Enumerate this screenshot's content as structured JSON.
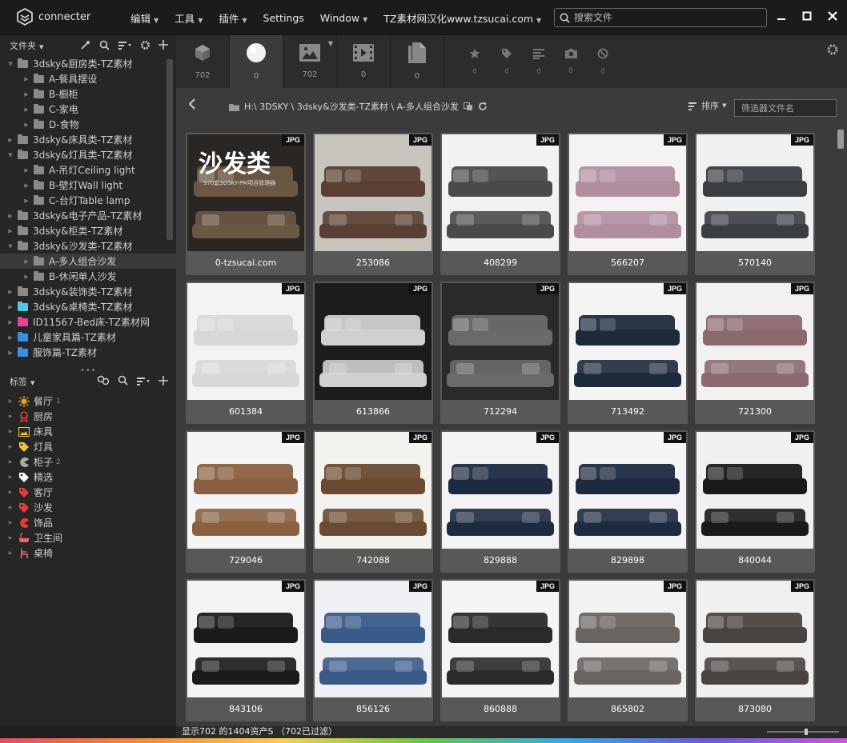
{
  "app": {
    "name": "connecter"
  },
  "menu": {
    "items": [
      {
        "label": "编辑",
        "dropdown": true
      },
      {
        "label": "工具",
        "dropdown": true
      },
      {
        "label": "插件",
        "dropdown": true
      },
      {
        "label": "Settings",
        "dropdown": false
      },
      {
        "label": "Window",
        "dropdown": true
      },
      {
        "label": "TZ素材网汉化www.tzsucai.com",
        "dropdown": true
      }
    ],
    "search_placeholder": "搜索文件"
  },
  "sidebar": {
    "folders_title": "文件夹",
    "folders": [
      {
        "label": "3dsky&厨房类-TZ素材",
        "level": 0,
        "expanded": true,
        "color": "#8a8a8a"
      },
      {
        "label": "A-餐具摆设",
        "level": 1,
        "color": "#8a8a8a"
      },
      {
        "label": "B-橱柜",
        "level": 1,
        "color": "#8a8a8a"
      },
      {
        "label": "C-家电",
        "level": 1,
        "color": "#8a8a8a"
      },
      {
        "label": "D-食物",
        "level": 1,
        "color": "#8a8a8a"
      },
      {
        "label": "3dsky&床具类-TZ素材",
        "level": 0,
        "color": "#8a8a8a"
      },
      {
        "label": "3dsky&灯具类-TZ素材",
        "level": 0,
        "expanded": true,
        "color": "#8a8a8a"
      },
      {
        "label": "A-吊灯Ceiling light",
        "level": 1,
        "color": "#8a8a8a"
      },
      {
        "label": "B-壁灯Wall light",
        "level": 1,
        "color": "#8a8a8a"
      },
      {
        "label": "C-台灯Table lamp",
        "level": 1,
        "color": "#8a8a8a"
      },
      {
        "label": "3dsky&电子产品-TZ素材",
        "level": 0,
        "color": "#8a8a8a"
      },
      {
        "label": "3dsky&柜类-TZ素材",
        "level": 0,
        "color": "#8a8a8a"
      },
      {
        "label": "3dsky&沙发类-TZ素材",
        "level": 0,
        "expanded": true,
        "color": "#8a8a8a"
      },
      {
        "label": "A-多人组合沙发",
        "level": 1,
        "selected": true,
        "color": "#8a8a8a"
      },
      {
        "label": "B-休闲单人沙发",
        "level": 1,
        "color": "#8a8a8a"
      },
      {
        "label": "3dsky&装饰类-TZ素材",
        "level": 0,
        "color": "#8a8a8a"
      },
      {
        "label": "3dsky&桌椅类-TZ素材",
        "level": 0,
        "color": "#4ec9e8"
      },
      {
        "label": "ID11567-Bed床-TZ素材网",
        "level": 0,
        "color": "#e84393"
      },
      {
        "label": "儿童家具篇-TZ素材",
        "level": 0,
        "color": "#3a8ee6"
      },
      {
        "label": "服饰篇-TZ素材",
        "level": 0,
        "color": "#3a8ee6"
      }
    ],
    "tags_title": "标签",
    "tags": [
      {
        "label": "餐厅",
        "count": "1",
        "icon": "sun-icon",
        "color": "#f0a020"
      },
      {
        "label": "厨房",
        "count": "",
        "icon": "badge-icon",
        "color": "#e83a3a"
      },
      {
        "label": "床具",
        "count": "",
        "icon": "image-icon",
        "color": "#f0c040"
      },
      {
        "label": "灯具",
        "count": "",
        "icon": "tag-icon",
        "color": "#f0c040"
      },
      {
        "label": "柜子",
        "count": "2",
        "icon": "pacman-icon",
        "color": "#aaaaaa"
      },
      {
        "label": "精选",
        "count": "",
        "icon": "tag-icon",
        "color": "#ffffff"
      },
      {
        "label": "客厅",
        "count": "",
        "icon": "tag-icon",
        "color": "#e83a3a"
      },
      {
        "label": "沙发",
        "count": "",
        "icon": "tag-icon",
        "color": "#e83a3a"
      },
      {
        "label": "饰品",
        "count": "",
        "icon": "pacman-icon",
        "color": "#e83a3a"
      },
      {
        "label": "卫生间",
        "count": "",
        "icon": "bathtub-icon",
        "color": "#e86a6a"
      },
      {
        "label": "桌椅",
        "count": "",
        "icon": "chair-icon",
        "color": "#e86a6a"
      }
    ]
  },
  "type_tabs": [
    {
      "name": "3d-model",
      "count": "702",
      "active": false
    },
    {
      "name": "material",
      "count": "0",
      "active": true
    },
    {
      "name": "image",
      "count": "702",
      "active": false
    },
    {
      "name": "video",
      "count": "0",
      "active": false
    },
    {
      "name": "document",
      "count": "0",
      "active": false
    }
  ],
  "meta_tabs": [
    {
      "name": "star",
      "count": "0"
    },
    {
      "name": "tag",
      "count": "0"
    },
    {
      "name": "text",
      "count": "0"
    },
    {
      "name": "camera",
      "count": "0"
    },
    {
      "name": "untagged",
      "count": "0"
    }
  ],
  "path": {
    "text": "H:\\ 3DSKY \\ 3dsky&沙发类-TZ素材 \\ A-多人组合沙发"
  },
  "sort_label": "排序",
  "filter_placeholder": "筛选器文件名",
  "assets": [
    {
      "label": "0-tzsucai.com",
      "badge": "JPG",
      "c1": "#2a2623",
      "c2": "#6b5844",
      "title": "沙发类",
      "sub": "970套3DSKY-PM项目管理器"
    },
    {
      "label": "253086",
      "badge": "JPG",
      "c1": "#c8c4be",
      "c2": "#5a4034"
    },
    {
      "label": "408299",
      "badge": "JPG",
      "c1": "#f2f2f2",
      "c2": "#4a4a48"
    },
    {
      "label": "566207",
      "badge": "JPG",
      "c1": "#f4f2f2",
      "c2": "#b08ea0"
    },
    {
      "label": "570140",
      "badge": "JPG",
      "c1": "#f0f0f0",
      "c2": "#3a3d42"
    },
    {
      "label": "601384",
      "badge": "JPG",
      "c1": "#f3f3f3",
      "c2": "#d8d8d8"
    },
    {
      "label": "613866",
      "badge": "JPG",
      "c1": "#1c1c1e",
      "c2": "#d0d0d0"
    },
    {
      "label": "712294",
      "badge": "JPG",
      "c1": "#2a2a2a",
      "c2": "#6a6a6a"
    },
    {
      "label": "713492",
      "badge": "JPG",
      "c1": "#f4f4f4",
      "c2": "#1e2a3a"
    },
    {
      "label": "721300",
      "badge": "JPG",
      "c1": "#f2f0f0",
      "c2": "#8a6a6e"
    },
    {
      "label": "729046",
      "badge": "JPG",
      "c1": "#f5f5f5",
      "c2": "#8a6040"
    },
    {
      "label": "742088",
      "badge": "JPG",
      "c1": "#f4f2ef",
      "c2": "#6a4a30"
    },
    {
      "label": "829888",
      "badge": "JPG",
      "c1": "#f3f3f3",
      "c2": "#1e2a40"
    },
    {
      "label": "829898",
      "badge": "JPG",
      "c1": "#f4f4f4",
      "c2": "#1e2a40"
    },
    {
      "label": "840044",
      "badge": "JPG",
      "c1": "#f2f0ee",
      "c2": "#1a1a1a"
    },
    {
      "label": "843106",
      "badge": "JPG",
      "c1": "#f3f3f3",
      "c2": "#1a1a1a"
    },
    {
      "label": "856126",
      "badge": "JPG",
      "c1": "#eef0f4",
      "c2": "#3a5a8a"
    },
    {
      "label": "860888",
      "badge": "JPG",
      "c1": "#f4f4f4",
      "c2": "#2a2a2a"
    },
    {
      "label": "865802",
      "badge": "JPG",
      "c1": "#f3f2f0",
      "c2": "#6a6460"
    },
    {
      "label": "873080",
      "badge": "JPG",
      "c1": "#f2f0ee",
      "c2": "#4a4440"
    }
  ],
  "status": {
    "text": "显示702 的1404资产S （702已过滤）",
    "zoom": 0.55
  }
}
